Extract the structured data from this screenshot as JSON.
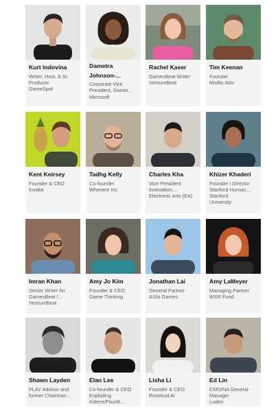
{
  "speakers": [
    {
      "name": [
        "Kurt Indovina"
      ],
      "lines": [
        "Writer, Host, & Sr.",
        "Producer",
        "GameSpot"
      ]
    },
    {
      "name": [
        "Dametra",
        "Johnson-..."
      ],
      "lines": [
        "Corporate Vice",
        "President, Gamin...",
        "Microsoft"
      ]
    },
    {
      "name": [
        "Rachel Kaser"
      ],
      "lines": [
        "GamesBeat Writer",
        "VentureBeat"
      ]
    },
    {
      "name": [
        "Tim Keenan"
      ],
      "lines": [
        "Founder",
        "Misfits Attic"
      ]
    },
    {
      "name": [
        "Kent Keirsey"
      ],
      "lines": [
        "Founder & CEO",
        "Invoke"
      ]
    },
    {
      "name": [
        "Tadhg Kelly"
      ],
      "lines": [
        "Co-founder",
        "Whenere Inc"
      ]
    },
    {
      "name": [
        "Charles Kha"
      ],
      "lines": [
        "Vice President",
        "Innovation,...",
        "Electronic Arts (EA)"
      ]
    },
    {
      "name": [
        "Khizer Khaderi"
      ],
      "lines": [
        "Founder | Director",
        "Stanford Human...",
        "Stanford",
        "University"
      ]
    },
    {
      "name": [
        "Imran Khan"
      ],
      "lines": [
        "Senior Writer for",
        "GamesBeat /...",
        "VentureBeat"
      ]
    },
    {
      "name": [
        "Amy Jo Kim"
      ],
      "lines": [
        "Founder & CEO",
        "Game Thinking"
      ]
    },
    {
      "name": [
        "Jonathan Lai"
      ],
      "lines": [
        "General Partner",
        "A16z Games"
      ]
    },
    {
      "name": [
        "Amy LaMeyer"
      ],
      "lines": [
        "Managing Partner",
        "WXR Fund"
      ]
    },
    {
      "name": [
        "Shawn Layden"
      ],
      "lines": [
        "PLAY Advisor and",
        "former Chairman..."
      ]
    },
    {
      "name": [
        "Elan Lee"
      ],
      "lines": [
        "Co-founder & CEO",
        "Exploding",
        "Kittens/Fourth..."
      ]
    },
    {
      "name": [
        "Lisha Li"
      ],
      "lines": [
        "Founder & CEO",
        "Rosebud AI"
      ]
    },
    {
      "name": [
        "Ed Lin"
      ],
      "lines": [
        "CMO/NA General",
        "Manager",
        "Ludeo"
      ]
    }
  ]
}
